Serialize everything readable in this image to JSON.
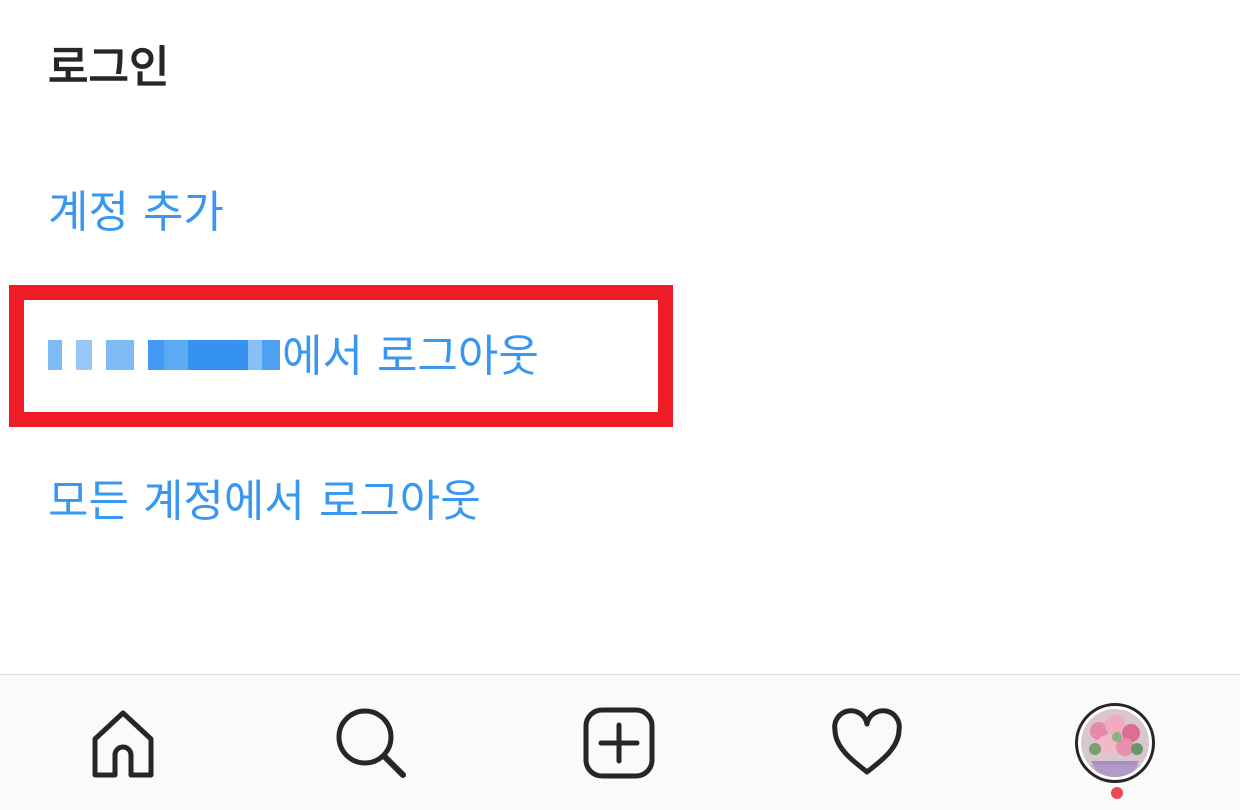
{
  "section": {
    "title": "로그인"
  },
  "menu": {
    "add_account": "계정 추가",
    "logout_account_suffix": "에서 로그아웃",
    "logout_all": "모든 계정에서 로그아웃"
  },
  "colors": {
    "link_blue": "#3897f0",
    "highlight_red": "#ee1c25",
    "text_dark": "#262626",
    "notification_dot": "#ed4956"
  },
  "tab_bar": {
    "tabs": [
      {
        "icon": "home-icon"
      },
      {
        "icon": "search-icon"
      },
      {
        "icon": "new-post-icon"
      },
      {
        "icon": "heart-icon"
      },
      {
        "icon": "profile-avatar"
      }
    ]
  }
}
